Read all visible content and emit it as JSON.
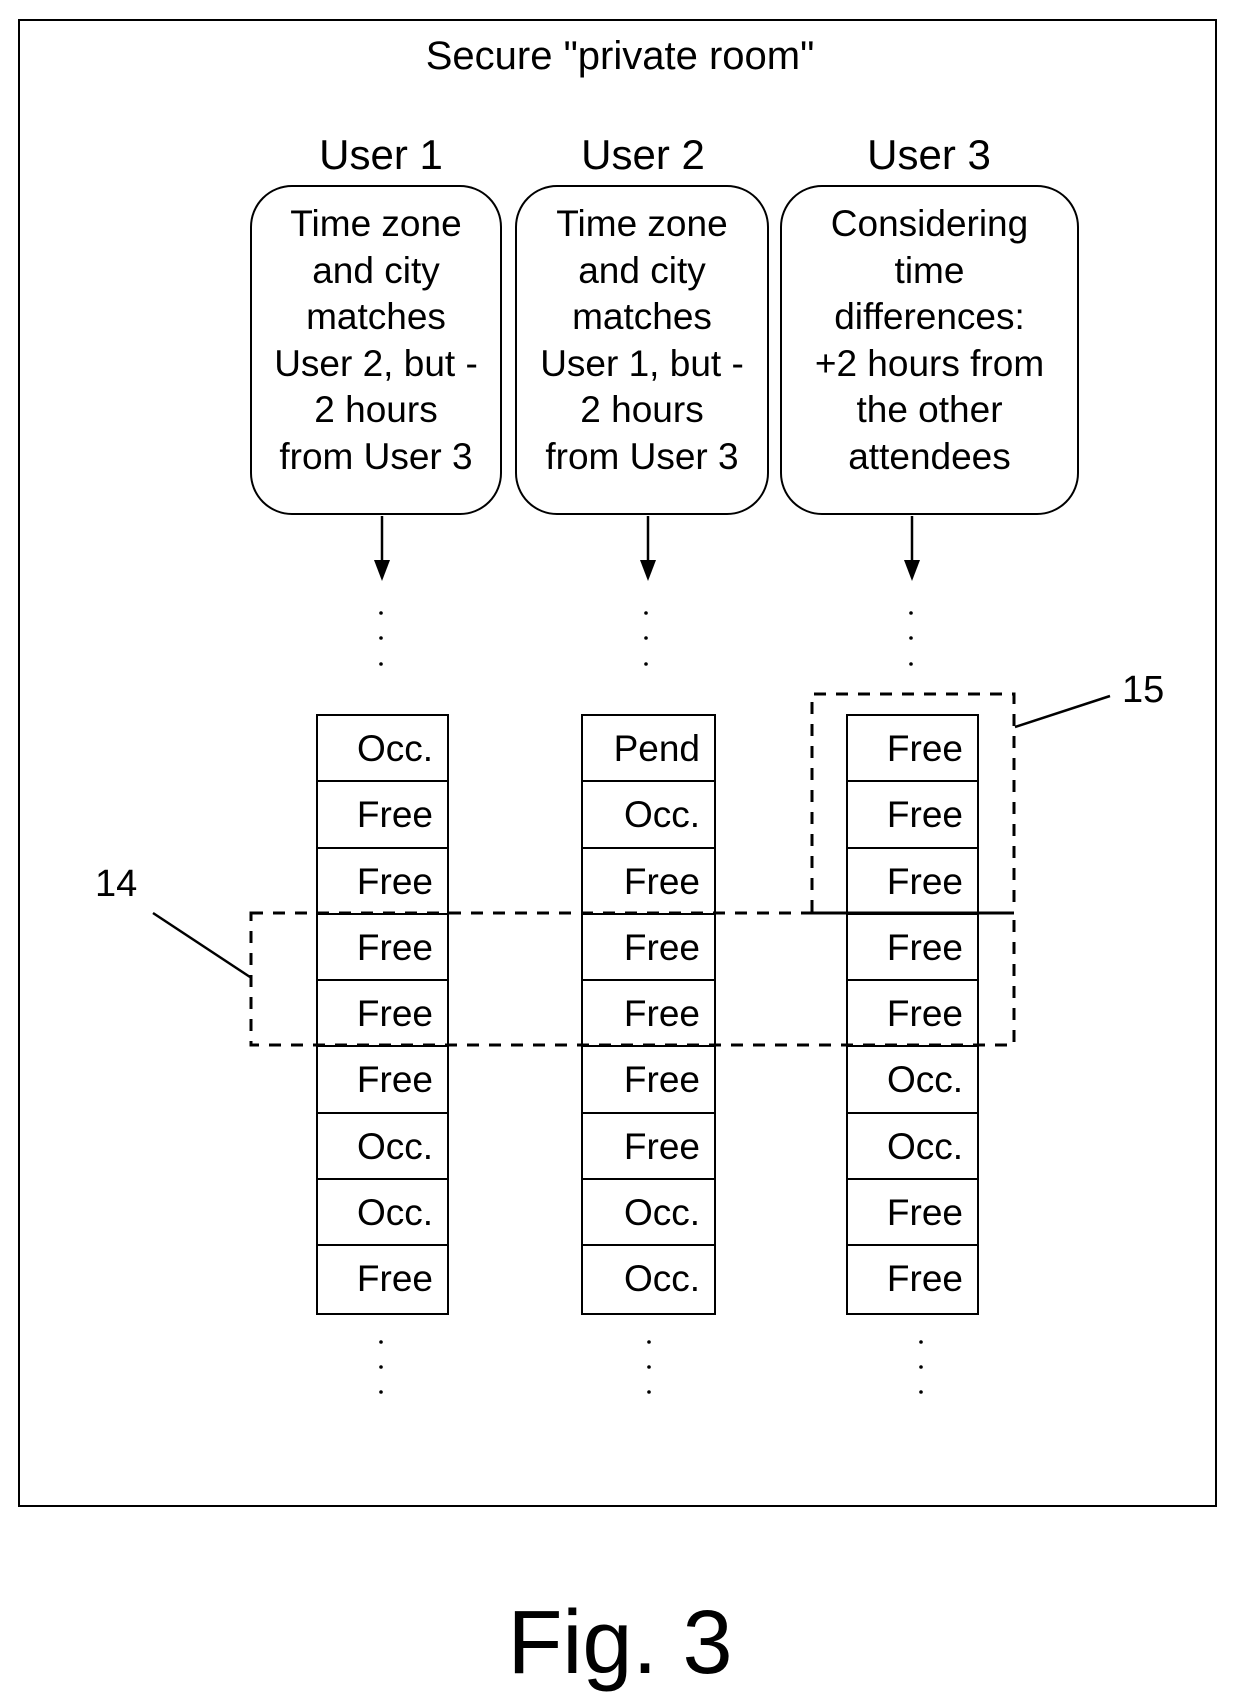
{
  "title": "Secure \"private room\"",
  "users": [
    {
      "label": "User 1",
      "description": "Time zone\nand city\nmatches\nUser 2, but -\n2 hours\nfrom User 3",
      "slots": [
        "Occ.",
        "Free",
        "Free",
        "Free",
        "Free",
        "Free",
        "Occ.",
        "Occ.",
        "Free"
      ]
    },
    {
      "label": "User 2",
      "description": "Time zone\nand city\nmatches\nUser 1, but -\n2 hours\nfrom User 3",
      "slots": [
        "Pend",
        "Occ.",
        "Free",
        "Free",
        "Free",
        "Free",
        "Free",
        "Occ.",
        "Occ."
      ]
    },
    {
      "label": "User 3",
      "description": "Considering\ntime\ndifferences:\n+2 hours from\nthe other\nattendees",
      "slots": [
        "Free",
        "Free",
        "Free",
        "Free",
        "Free",
        "Occ.",
        "Occ.",
        "Free",
        "Free"
      ]
    }
  ],
  "reference_labels": {
    "common_free_window": "14",
    "user3_free_window": "15"
  },
  "highlighted_slots": {
    "common_free_window": {
      "users": [
        1,
        2,
        3
      ],
      "slot_indices": [
        3,
        4
      ]
    },
    "user3_free_window": {
      "users": [
        3
      ],
      "slot_indices": [
        0,
        1,
        2
      ]
    }
  },
  "caption": "Fig. 3"
}
